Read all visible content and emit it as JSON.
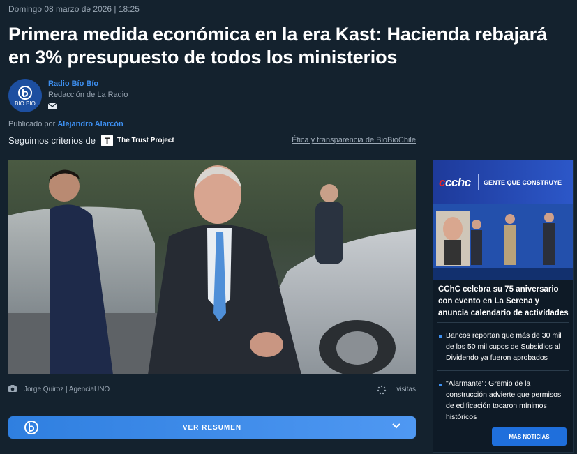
{
  "article": {
    "date": "Domingo 08 marzo de 2026 | 18:25",
    "title": "Primera medida económica en la era Kast: Hacienda rebajará en 3% presupuesto de todos los ministerios"
  },
  "author": {
    "avatar_text": "BIO BIO",
    "name": "Radio Bío Bío",
    "role": "Redacción de La Radio"
  },
  "published": {
    "label": "Publicado por",
    "name": "Alejandro Alarcón"
  },
  "criteria": {
    "label": "Seguimos criterios de",
    "logo_letter": "T",
    "project_name": "The Trust Project",
    "ethics_link": "Ética y transparencia de BioBioChile"
  },
  "photo": {
    "credit": "Jorge Quiroz | AgenciaUNO",
    "visits_label": "visitas"
  },
  "summary": {
    "button_label": "VER RESUMEN"
  },
  "sidebar": {
    "banner_logo": "cchc",
    "banner_slogan": "GENTE QUE CONSTRUYE",
    "headline": "CChC celebra su 75 aniversario con evento en La Serena y anuncia calendario de actividades",
    "items": [
      {
        "text": "Bancos reportan que más de 30 mil de los 50 mil cupos de Subsidios al Dividendo ya fueron aprobados"
      },
      {
        "text": "\"Alarmante\": Gremio de la construcción advierte que permisos de edificación tocaron mínimos históricos"
      }
    ],
    "more_button": "MÁS NOTICIAS"
  },
  "colors": {
    "background": "#14222e",
    "link_blue": "#3d8ff0",
    "button_blue": "#1f6fdc",
    "cchc_red": "#e2232b"
  },
  "icons": [
    "mail-icon",
    "camera-icon",
    "spinner-icon",
    "biobio-logo-icon",
    "chevron-down-icon"
  ]
}
